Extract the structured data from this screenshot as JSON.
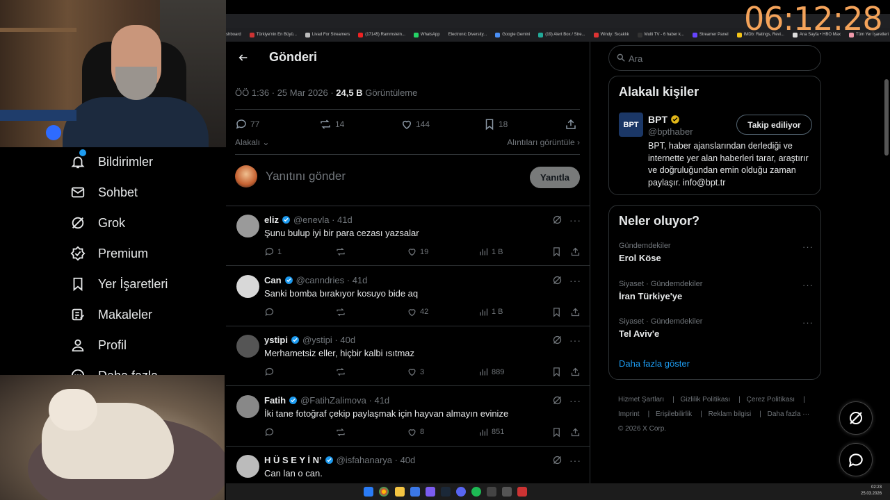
{
  "overlay": {
    "clock": "06:12:28"
  },
  "bookmarks": [
    "shboard",
    "Türkiye'nin En Büyü...",
    "Livad For Streamers",
    "(17145) Rammstein...",
    "WhatsApp",
    "Electronic Diversity...",
    "Google Gemini",
    "(19) Alert Box / Stre...",
    "Windy: Sıcaklık",
    "Multi TV - 6 haber k...",
    "Streamer Panel",
    "IMDb: Ratings, Revi...",
    "Ana Sayfa • HBO Max",
    "Tüm Yer İşaretleri"
  ],
  "nav": {
    "items": [
      {
        "label": "Bildirimler",
        "icon": "bell-icon"
      },
      {
        "label": "Sohbet",
        "icon": "mail-icon"
      },
      {
        "label": "Grok",
        "icon": "grok-icon"
      },
      {
        "label": "Premium",
        "icon": "premium-icon"
      },
      {
        "label": "Yer İşaretleri",
        "icon": "bookmark-icon"
      },
      {
        "label": "Makaleler",
        "icon": "article-icon"
      },
      {
        "label": "Profil",
        "icon": "person-icon"
      },
      {
        "label": "Daha fazla",
        "icon": "more-circle-icon"
      }
    ]
  },
  "header": {
    "title": "Gönderi"
  },
  "post": {
    "time": "ÖÖ 1:36",
    "date": "25 Mar 2026",
    "views": "24,5 B",
    "views_label": "Görüntüleme",
    "replies": "77",
    "reposts": "14",
    "likes": "144",
    "bookmarks": "18",
    "relevance": "Alakalı",
    "quotes_link": "Alıntıları görüntüle"
  },
  "reply_box": {
    "placeholder": "Yanıtını gönder",
    "button": "Yanıtla"
  },
  "replies": [
    {
      "name": "eliz",
      "handle": "@enevla",
      "age": "41d",
      "text": "Şunu bulup iyi bir para cezası yazsalar",
      "replies": "1",
      "reposts": "",
      "likes": "19",
      "views": "1 B"
    },
    {
      "name": "Can",
      "handle": "@canndries",
      "age": "41d",
      "text": "Sanki bomba bırakıyor kosuyo bide aq",
      "replies": "",
      "reposts": "",
      "likes": "42",
      "views": "1 B"
    },
    {
      "name": "ystipi",
      "handle": "@ystipi",
      "age": "40d",
      "text": "Merhametsiz eller, hiçbir kalbi ısıtmaz",
      "replies": "",
      "reposts": "",
      "likes": "3",
      "views": "889"
    },
    {
      "name": "Fatih",
      "handle": "@FatihZalimova",
      "age": "41d",
      "text": "İki tane fotoğraf çekip paylaşmak için hayvan almayın evinize",
      "replies": "",
      "reposts": "",
      "likes": "8",
      "views": "851"
    },
    {
      "name": "H Ü S E Y İ N’",
      "handle": "@isfahanarya",
      "age": "40d",
      "text": "Can lan o can.",
      "replies": "",
      "reposts": "",
      "likes": "",
      "views": ""
    }
  ],
  "search": {
    "placeholder": "Ara"
  },
  "people": {
    "title": "Alakalı kişiler",
    "name": "BPT",
    "avatar_text": "BPT",
    "handle": "@bpthaber",
    "follow_label": "Takip ediliyor",
    "bio": "BPT, haber ajanslarından derlediği ve internette yer alan haberleri tarar, araştırır ve doğruluğundan emin olduğu zaman paylaşır. info@bpt.tr"
  },
  "trends": {
    "title": "Neler oluyor?",
    "items": [
      {
        "category": "Gündemdekiler",
        "name": "Erol Köse"
      },
      {
        "category": "Siyaset · Gündemdekiler",
        "name": "İran Türkiye'ye"
      },
      {
        "category": "Siyaset · Gündemdekiler",
        "name": "Tel Aviv'e"
      }
    ],
    "show_more": "Daha fazla göster"
  },
  "footer": {
    "links": [
      "Hizmet Şartları",
      "Gizlilik Politikası",
      "Çerez Politikası",
      "Imprint",
      "Erişilebilirlik",
      "Reklam bilgisi",
      "Daha fazla ···",
      "© 2026 X Corp."
    ]
  },
  "taskbar": {
    "time": "02:23",
    "date": "25.03.2026"
  },
  "colors": {
    "accent": "#1d9bf0",
    "overlay_clock": "#f4a35a",
    "verified_gold": "#e2b719"
  }
}
